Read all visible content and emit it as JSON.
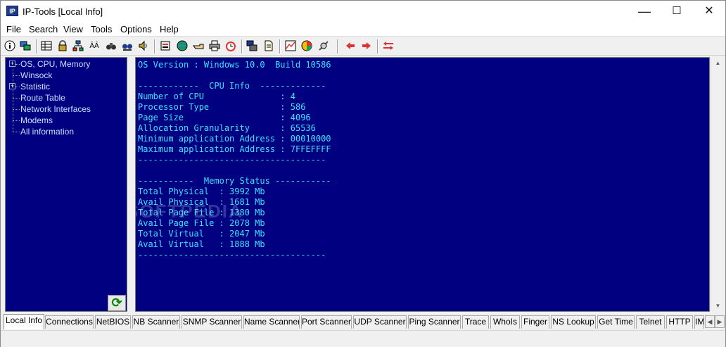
{
  "titlebar": {
    "app_icon_text": "IP",
    "title": "IP-Tools [Local Info]",
    "minimize": "—",
    "maximize": "☐",
    "close": "✕"
  },
  "menu": [
    "File",
    "Search",
    "View",
    "Tools",
    "Options",
    "Help"
  ],
  "toolbar_icons": [
    "info-icon",
    "network-computers-icon",
    "table-icon",
    "lock-icon",
    "network-tree-icon",
    "name-icon",
    "binoculars-icon",
    "binoculars-search-icon",
    "speaker-icon",
    "traffic-icon",
    "globe-icon",
    "finger-icon",
    "printer-icon",
    "alarm-clock-icon",
    "computers-icon",
    "document-icon",
    "chart-icon",
    "pie-chart-icon",
    "satellite-icon",
    "arrow-left-icon",
    "arrow-right-icon",
    "arrows-exchange-icon"
  ],
  "tree": {
    "items": [
      {
        "label": "OS, CPU, Memory",
        "expandable": true
      },
      {
        "label": "Winsock",
        "expandable": false
      },
      {
        "label": "Statistic",
        "expandable": true
      },
      {
        "label": "Route Table",
        "expandable": false
      },
      {
        "label": "Network Interfaces",
        "expandable": false
      },
      {
        "label": "Modems",
        "expandable": false
      },
      {
        "label": "All information",
        "expandable": false
      }
    ],
    "expander_glyph": "+"
  },
  "refresh_glyph": "⟳",
  "console_text": "OS Version : Windows 10.0  Build 10586\n\n------------  CPU Info  -------------\nNumber of CPU               : 4\nProcessor Type              : 586\nPage Size                   : 4096\nAllocation Granularity      : 65536\nMinimum application Address : 00010000\nMaximum application Address : 7FFEFFFF\n-------------------------------------\n\n-----------  Memory Status -----------\nTotal Physical  : 3992 Mb\nAvail Physical  : 1681 Mb\nTotal Page File : 1380 Mb\nAvail Page File : 2078 Mb\nTotal Virtual   : 2047 Mb\nAvail Virtual   : 1888 Mb\n-------------------------------------",
  "watermark": "SOFTPEDIA",
  "scroll_up": "▲",
  "scroll_down": "▼",
  "tabs": [
    "Local Info",
    "Connections",
    "NetBIOS",
    "NB Scanner",
    "SNMP Scanner",
    "Name Scanner",
    "Port Scanner",
    "UDP Scanner",
    "Ping Scanner",
    "Trace",
    "WhoIs",
    "Finger",
    "NS Lookup",
    "Get Time",
    "Telnet",
    "HTTP",
    "IM"
  ],
  "active_tab": "Local Info",
  "tab_scroll_left": "◀",
  "tab_scroll_right": "▶",
  "colors": {
    "pane_bg": "#000080",
    "console_text": "#3be3ff",
    "tree_text": "#bfe0ff"
  }
}
